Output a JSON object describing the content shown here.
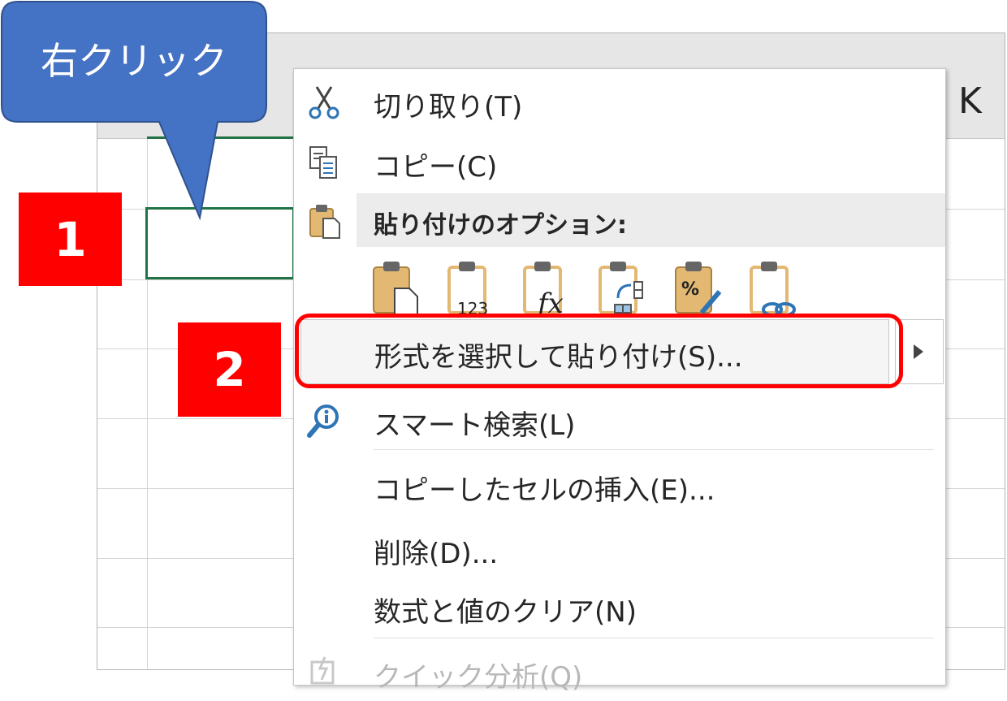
{
  "annotation": {
    "callout_text": "右クリック",
    "step1": "1",
    "step2": "2"
  },
  "sheet": {
    "column_letter": "K"
  },
  "context_menu": {
    "cut": "切り取り(T)",
    "copy": "コピー(C)",
    "paste_options_header": "貼り付けのオプション:",
    "paste_options": [
      "paste-icon",
      "paste-values-icon",
      "paste-formulas-icon",
      "paste-transpose-icon",
      "paste-formatting-icon",
      "paste-link-icon"
    ],
    "paste_special": "形式を選択して貼り付け(S)...",
    "smart_lookup": "スマート検索(L)",
    "insert_copied_cells": "コピーしたセルの挿入(E)...",
    "delete": "削除(D)...",
    "clear_contents": "数式と値のクリア(N)",
    "quick_analysis": "クイック分析(Q)"
  },
  "colors": {
    "callout": "#4472c4",
    "badge": "#ff0000",
    "selection": "#217346",
    "paste_icon": "#e2b872"
  }
}
